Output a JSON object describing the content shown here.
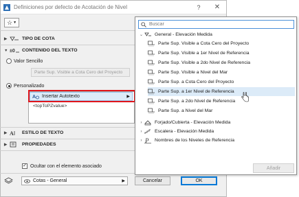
{
  "window": {
    "title": "Definiciones por defecto de Acotación de Nivel",
    "help": "?",
    "close": "✕"
  },
  "sections": {
    "tipo_cota": "TIPO DE COTA",
    "contenido": "CONTENIDO DEL TEXTO",
    "estilo": "ESTILO DE TEXTO",
    "propiedades": "PROPIEDADES"
  },
  "content": {
    "valor_sencillo": "Valor Sencillo",
    "valor_sencillo_field": "Parte Sup. Visible a Cota Cero del Proyecto",
    "personalizado": "Personalizado",
    "insertar_autotexto": "Insertar Autotexto",
    "autotext_tag": "<topToPZvalue>"
  },
  "footer": {
    "ocultar_label": "Ocultar con el elemento asociado",
    "layer": "Cotas - General",
    "cancel": "Cancelar",
    "ok": "OK"
  },
  "popup": {
    "search_placeholder": "Buscar",
    "group_general": "General - Elevación Medida",
    "items": [
      "Parte Sup. Visible a Cota Cero del Proyecto",
      "Parte Sup. Visible a 1er Nivel de Referencia",
      "Parte Sup. Visible a 2do Nivel de Referencia",
      "Parte Sup. Visible a Nivel del Mar",
      "Parte Sup. a Cota Cero del Proyecto",
      "Parte Sup. a 1er Nivel de Referencia",
      "Parte Sup. a 2do Nivel de Referencia",
      "Parte Sup. a Nivel del Mar"
    ],
    "selected_index": 5,
    "group_forjado": "Forjado/Cubierta - Elevación Medida",
    "group_escalera": "Escalera - Elevación Medida",
    "group_nombres": "Nombres de los Niveles de Referencia",
    "add_button": "Añadir"
  },
  "colors": {
    "highlight": "#dcebf8",
    "red_callout": "#e0151b",
    "ok_border": "#0078d7"
  }
}
